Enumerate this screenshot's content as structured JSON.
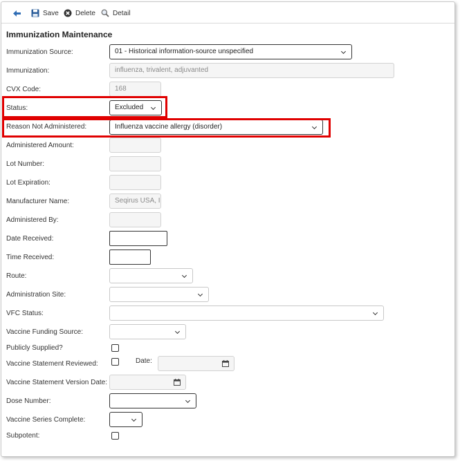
{
  "toolbar": {
    "back_icon": "back-arrow-icon",
    "save_icon": "floppy-disk-icon",
    "save_label": "Save",
    "delete_icon": "delete-circle-icon",
    "delete_label": "Delete",
    "detail_icon": "magnifier-icon",
    "detail_label": "Detail"
  },
  "title": "Immunization Maintenance",
  "fields": {
    "immunization_source": {
      "label": "Immunization Source:",
      "value": "01 - Historical information-source unspecified"
    },
    "immunization": {
      "label": "Immunization:",
      "value": "influenza, trivalent, adjuvanted"
    },
    "cvx_code": {
      "label": "CVX Code:",
      "value": "168"
    },
    "status": {
      "label": "Status:",
      "value": "Excluded"
    },
    "reason_not_administered": {
      "label": "Reason Not Administered:",
      "value": "Influenza vaccine allergy (disorder)"
    },
    "administered_amount": {
      "label": "Administered Amount:",
      "value": ""
    },
    "lot_number": {
      "label": "Lot Number:",
      "value": ""
    },
    "lot_expiration": {
      "label": "Lot Expiration:",
      "value": ""
    },
    "manufacturer_name": {
      "label": "Manufacturer Name:",
      "value": "Seqirus USA, I"
    },
    "administered_by": {
      "label": "Administered By:",
      "value": ""
    },
    "date_received": {
      "label": "Date Received:",
      "value": ""
    },
    "time_received": {
      "label": "Time Received:",
      "value": ""
    },
    "route": {
      "label": "Route:",
      "value": ""
    },
    "administration_site": {
      "label": "Administration Site:",
      "value": ""
    },
    "vfc_status": {
      "label": "VFC Status:",
      "value": ""
    },
    "vaccine_funding_source": {
      "label": "Vaccine Funding Source:",
      "value": ""
    },
    "publicly_supplied": {
      "label": "Publicly Supplied?",
      "checked": false
    },
    "vaccine_statement_reviewed": {
      "label": "Vaccine Statement Reviewed:",
      "checked": false,
      "date_label": "Date:",
      "date_value": ""
    },
    "vaccine_statement_version_date": {
      "label": "Vaccine Statement Version Date:",
      "value": ""
    },
    "dose_number": {
      "label": "Dose Number:",
      "value": ""
    },
    "vaccine_series_complete": {
      "label": "Vaccine Series Complete:",
      "value": ""
    },
    "subpotent": {
      "label": "Subpotent:",
      "checked": false
    }
  },
  "colors": {
    "highlight": "#e00000",
    "save_icon": "#2b5d9a",
    "back_icon": "#2f6db5"
  }
}
